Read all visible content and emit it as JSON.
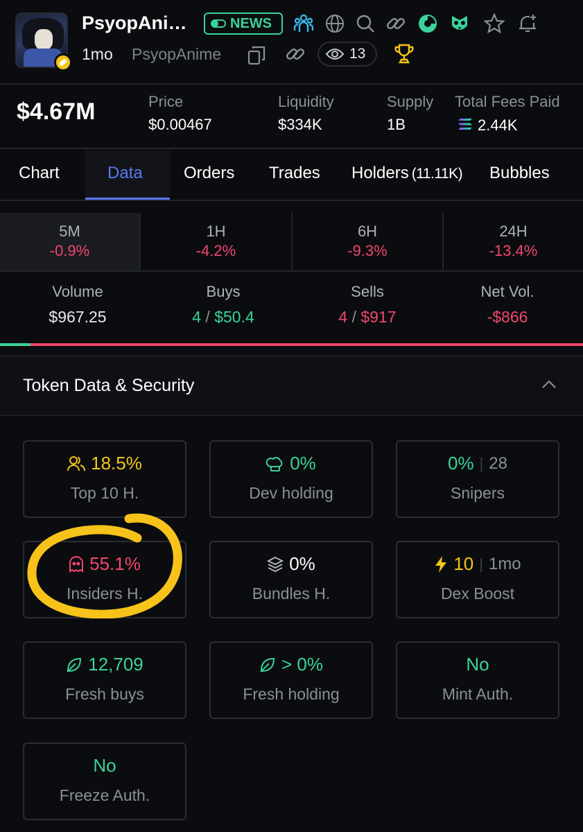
{
  "header": {
    "token_name": "PsyopAni…",
    "news_label": "NEWS",
    "age": "1mo",
    "handle": "PsyopAnime",
    "viewers": "13",
    "icons": [
      "people-icon",
      "globe-icon",
      "search-icon",
      "link-icon",
      "pie-chart-icon",
      "owl-icon",
      "star-icon",
      "bell-plus-icon"
    ]
  },
  "stats": {
    "market_cap": "$4.67M",
    "price_label": "Price",
    "price": "$0.00467",
    "liquidity_label": "Liquidity",
    "liquidity": "$334K",
    "supply_label": "Supply",
    "supply": "1B",
    "fees_label": "Total Fees Paid",
    "fees": "2.44K"
  },
  "tabs": [
    {
      "label": "Chart"
    },
    {
      "label": "Data"
    },
    {
      "label": "Orders"
    },
    {
      "label": "Trades"
    },
    {
      "label": "Holders",
      "count": "(11.11K)"
    },
    {
      "label": "Bubbles"
    }
  ],
  "timeframes": [
    {
      "label": "5M",
      "value": "-0.9%"
    },
    {
      "label": "1H",
      "value": "-4.2%"
    },
    {
      "label": "6H",
      "value": "-9.3%"
    },
    {
      "label": "24H",
      "value": "-13.4%"
    }
  ],
  "volume": {
    "volume_label": "Volume",
    "volume": "$967.25",
    "buys_label": "Buys",
    "buys_count": "4",
    "buys_value": "$50.4",
    "sells_label": "Sells",
    "sells_count": "4",
    "sells_value": "$917",
    "net_label": "Net Vol.",
    "net": "-$866",
    "buy_ratio": 0.052
  },
  "section": {
    "title": "Token Data & Security"
  },
  "cards": {
    "top10": {
      "value": "18.5%",
      "label": "Top 10 H."
    },
    "dev": {
      "value": "0%",
      "label": "Dev holding"
    },
    "snipers": {
      "value": "0%",
      "count": "28",
      "label": "Snipers"
    },
    "insiders": {
      "value": "55.1%",
      "label": "Insiders H."
    },
    "bundles": {
      "value": "0%",
      "label": "Bundles H."
    },
    "boost": {
      "value": "10",
      "age": "1mo",
      "label": "Dex Boost"
    },
    "fresh_buys": {
      "value": "12,709",
      "label": "Fresh buys"
    },
    "fresh_holding": {
      "value": "> 0%",
      "label": "Fresh holding"
    },
    "mint": {
      "value": "No",
      "label": "Mint Auth."
    },
    "freeze": {
      "value": "No",
      "label": "Freeze Auth."
    }
  },
  "colors": {
    "green": "#3ad39a",
    "red": "#f0476d",
    "accent": "#5b7bf0",
    "yellow": "#f5c518"
  }
}
